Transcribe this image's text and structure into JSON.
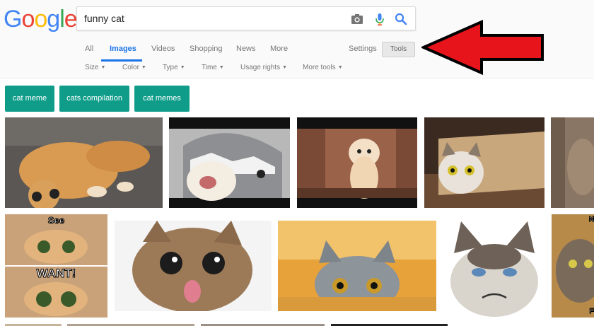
{
  "logo": {
    "letters": [
      "G",
      "o",
      "o",
      "g",
      "l",
      "e"
    ],
    "colors": [
      "#4285f4",
      "#ea4335",
      "#fbbc05",
      "#4285f4",
      "#34a853",
      "#ea4335"
    ]
  },
  "search": {
    "query": "funny cat"
  },
  "tabs": [
    {
      "label": "All",
      "active": false
    },
    {
      "label": "Images",
      "active": true
    },
    {
      "label": "Videos",
      "active": false
    },
    {
      "label": "Shopping",
      "active": false
    },
    {
      "label": "News",
      "active": false
    },
    {
      "label": "More",
      "active": false
    }
  ],
  "settings_label": "Settings",
  "tools_label": "Tools",
  "filters": [
    {
      "label": "Size"
    },
    {
      "label": "Color"
    },
    {
      "label": "Type"
    },
    {
      "label": "Time"
    },
    {
      "label": "Usage rights"
    },
    {
      "label": "More tools"
    }
  ],
  "chips": [
    "cat meme",
    "cats compilation",
    "cat memes"
  ],
  "overlay_text": {
    "see": "See",
    "want": "WANT!",
    "not": "NOT",
    "fun": "FUN"
  },
  "colors": {
    "accent_blue": "#1a73e8",
    "chip_teal": "#0f9d8a",
    "arrow_red": "#e8141b"
  }
}
